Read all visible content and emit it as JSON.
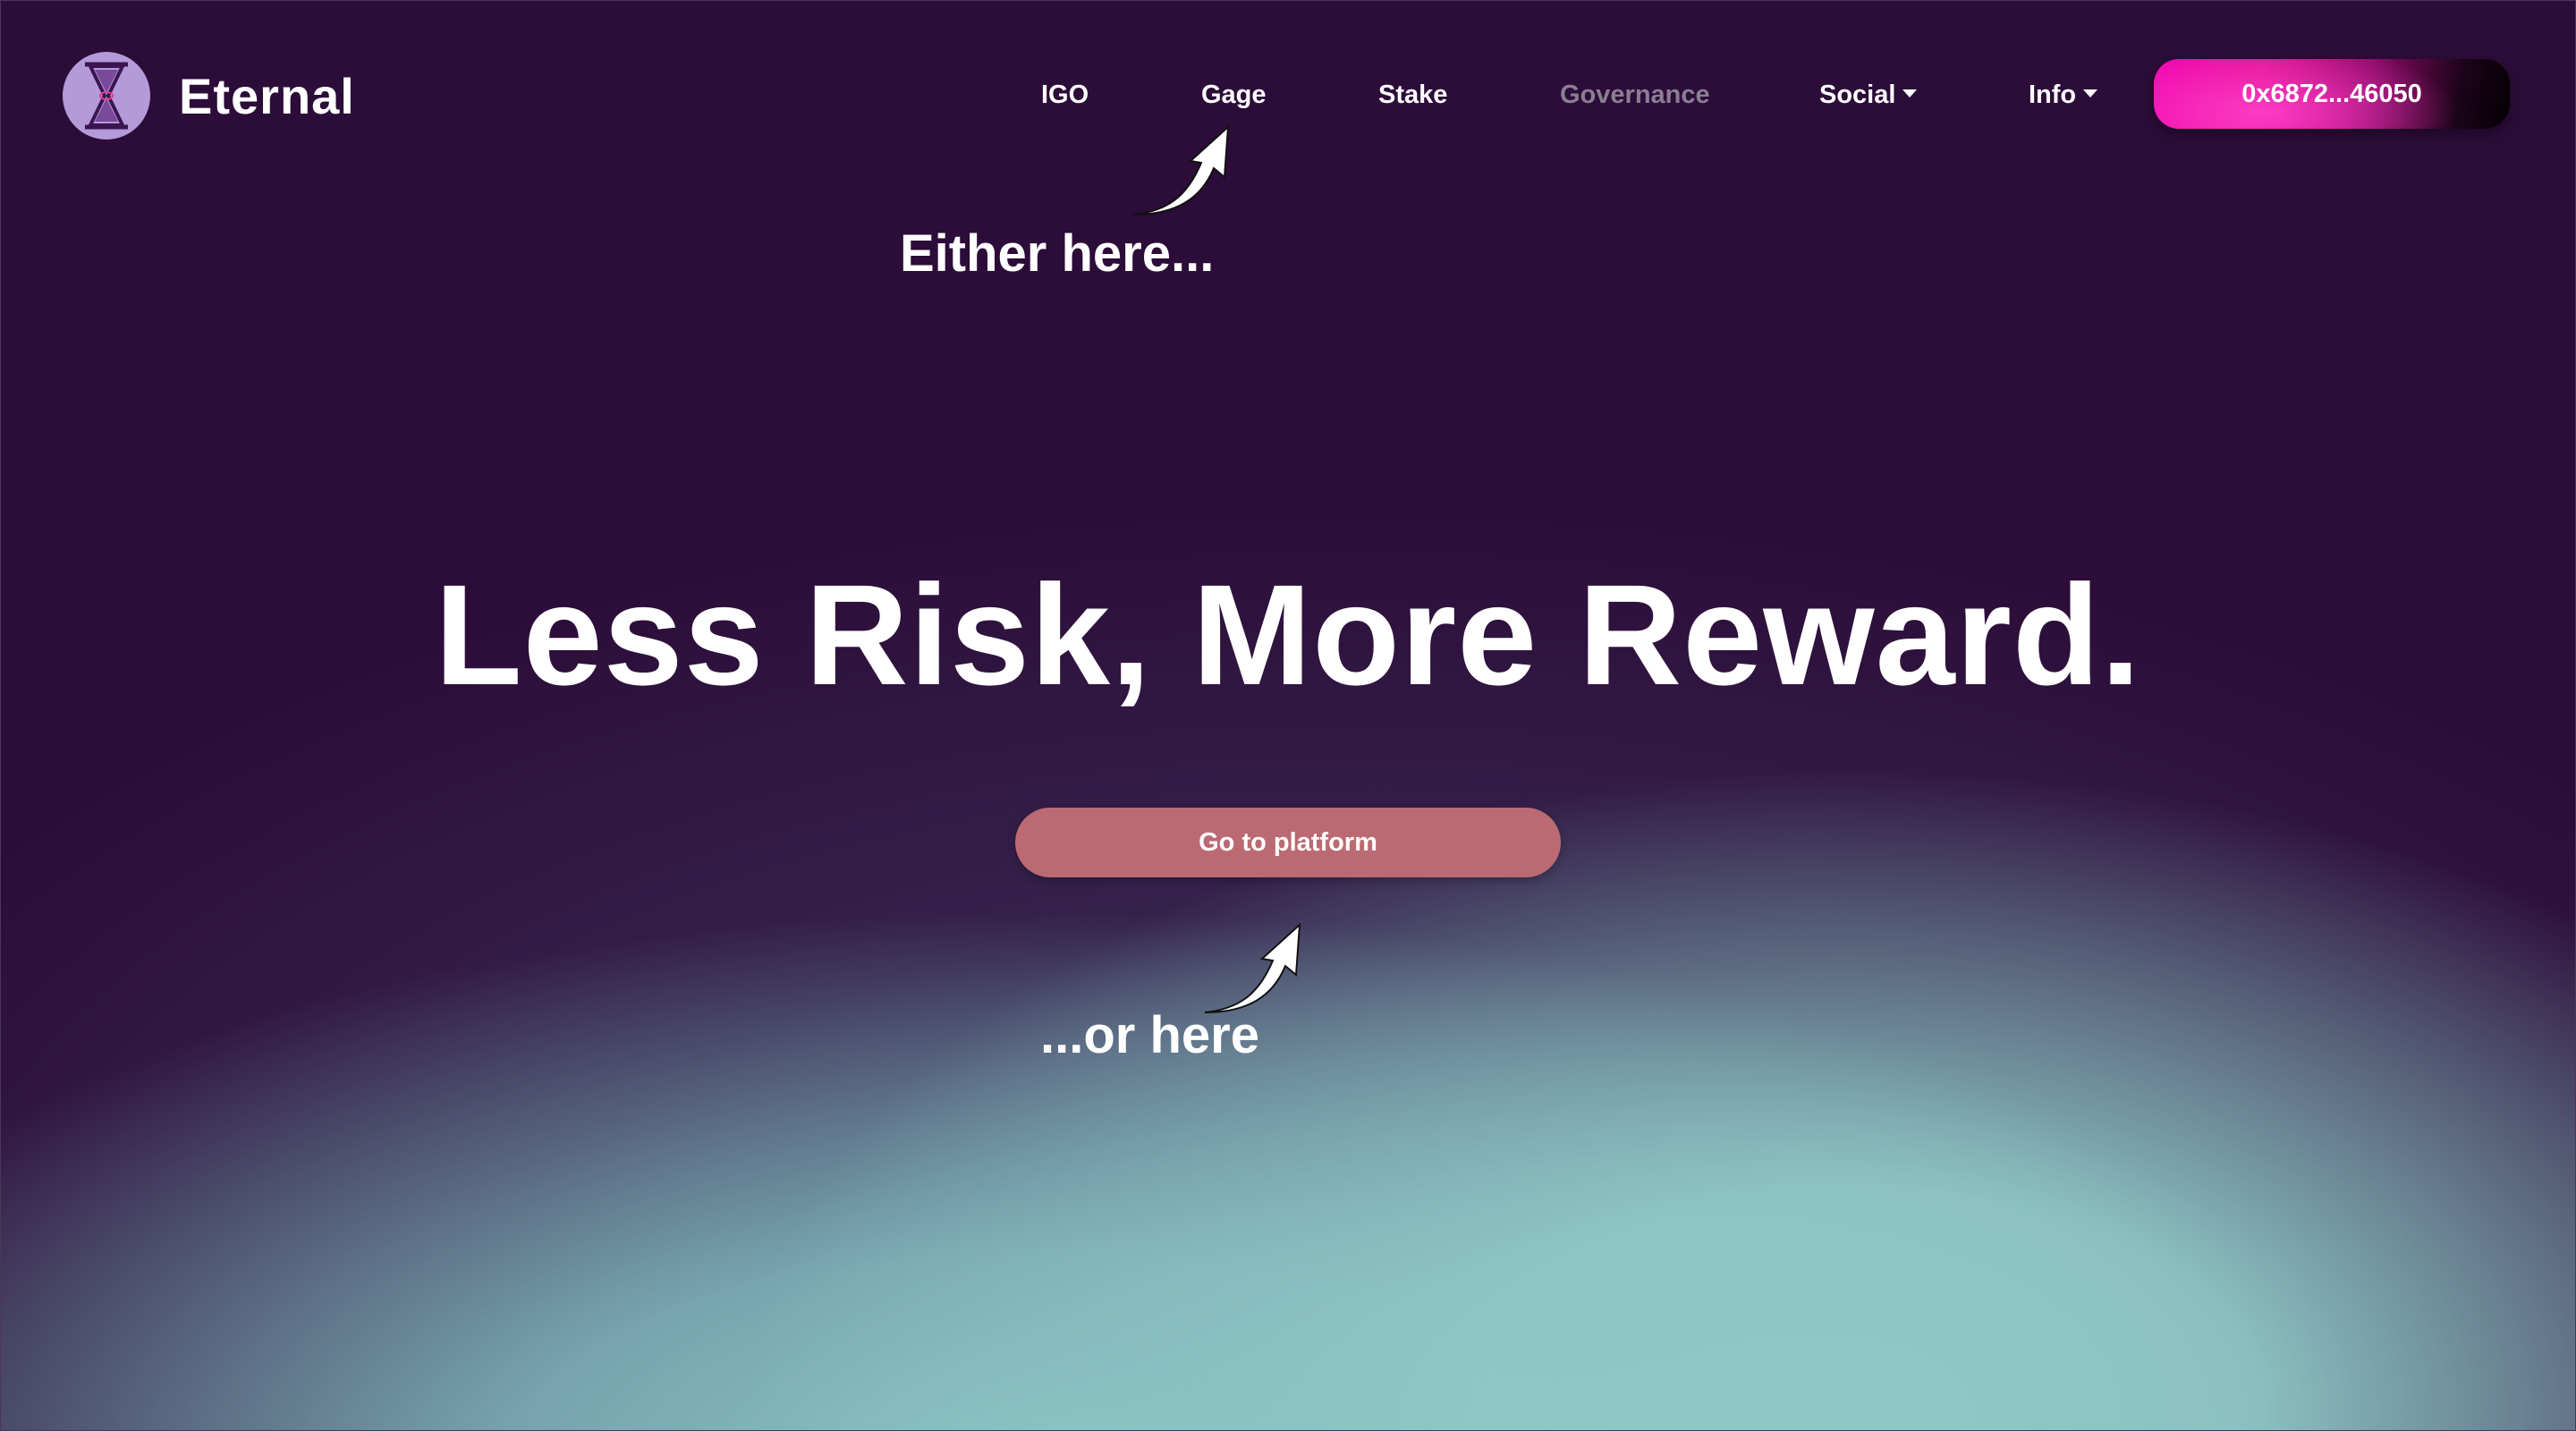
{
  "brand": {
    "name": "Eternal",
    "logo_color": "#b49ad8"
  },
  "nav": {
    "items": [
      {
        "label": "IGO"
      },
      {
        "label": "Gage"
      },
      {
        "label": "Stake"
      },
      {
        "label": "Governance",
        "disabled": true
      },
      {
        "label": "Social",
        "dropdown": true
      },
      {
        "label": "Info",
        "dropdown": true
      }
    ],
    "wallet_address": "0x6872...46050"
  },
  "hero": {
    "headline": "Less Risk, More Reward.",
    "cta_label": "Go to platform",
    "cta_color": "#bb6a73"
  },
  "annotations": {
    "top": "Either here...",
    "bottom": "...or here"
  },
  "colors": {
    "background": "#2c0c38",
    "glow": "#8fc8c7",
    "wallet_accent": "#f000b0"
  }
}
